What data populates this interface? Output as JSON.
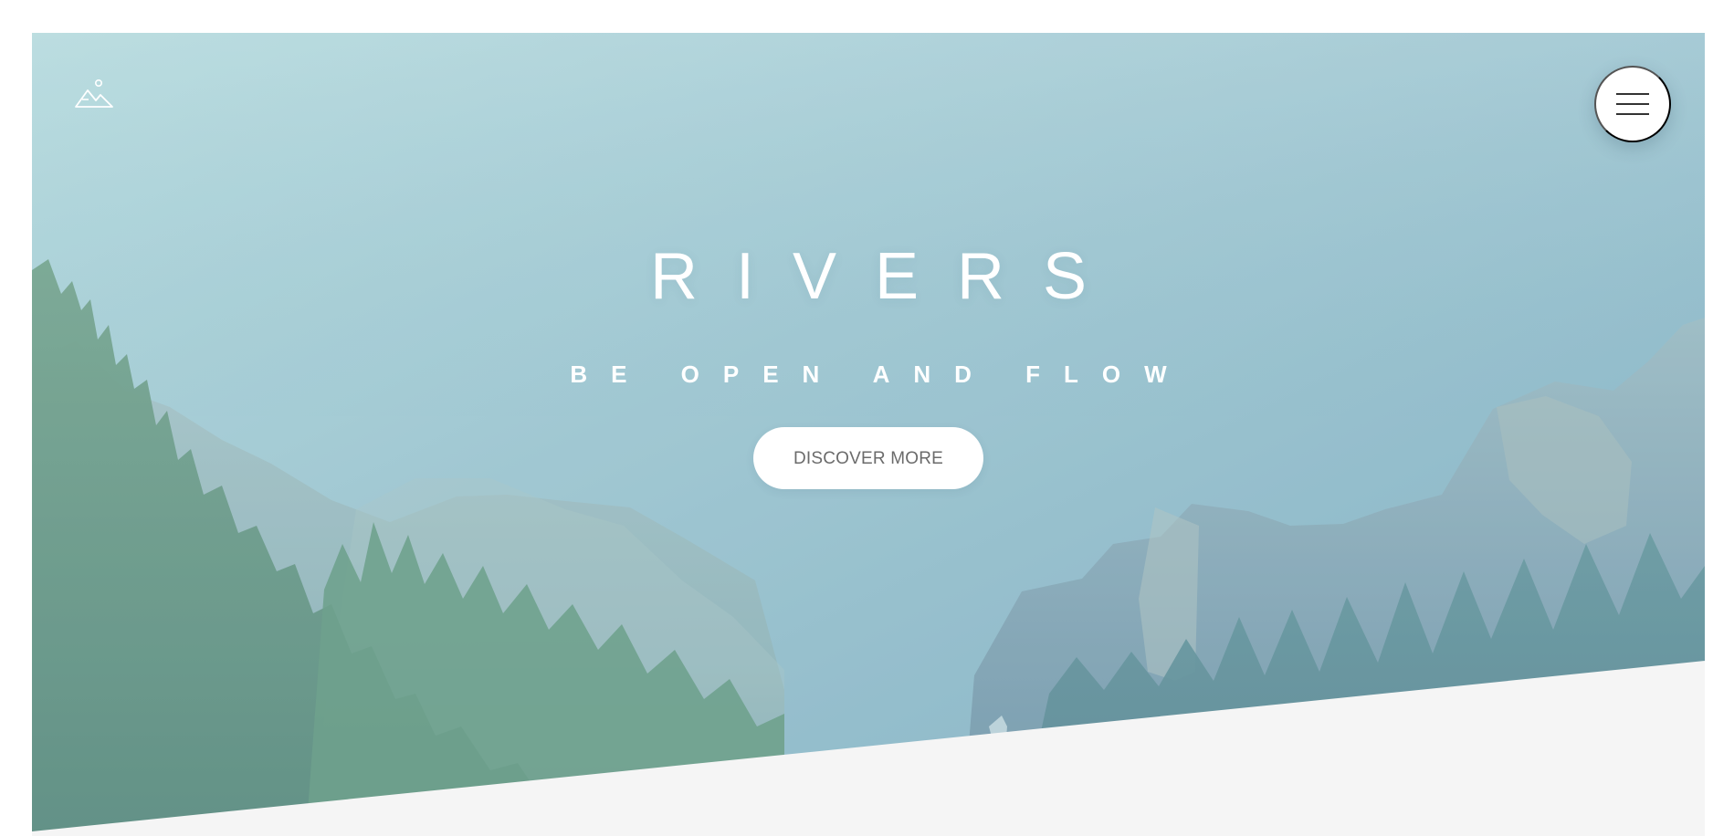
{
  "hero": {
    "title": "RIVERS",
    "subtitle": "BE OPEN AND FLOW",
    "cta_label": "DISCOVER MORE"
  },
  "header": {
    "logo_icon": "mountain-sun-icon",
    "menu_icon": "hamburger-menu-icon"
  },
  "colors": {
    "overlay": "#9fc6cf",
    "button_background": "#ffffff",
    "button_text": "#6b6b6b",
    "text": "#ffffff",
    "section_background": "#f5f5f5"
  }
}
